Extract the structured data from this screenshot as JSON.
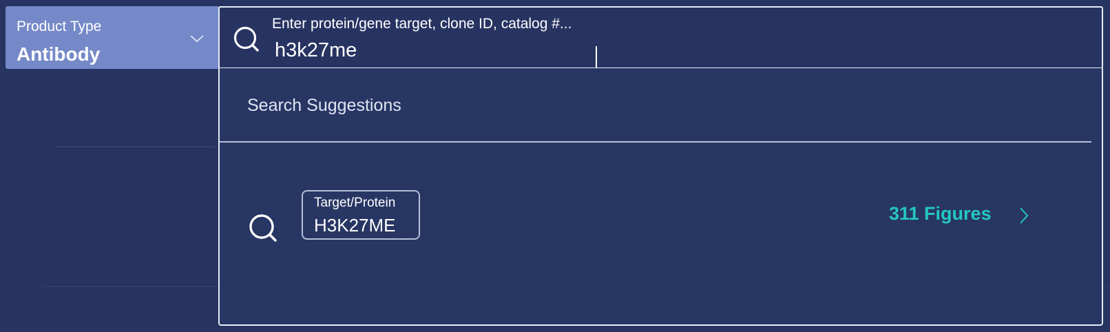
{
  "product_type": {
    "label": "Product Type",
    "value": "Antibody"
  },
  "search": {
    "placeholder": "Enter protein/gene target, clone ID, catalog #...",
    "value": "h3k27me"
  },
  "suggestions": {
    "heading": "Search Suggestions",
    "items": [
      {
        "category": "Target/Protein",
        "term": "H3K27ME",
        "figures": "311 Figures"
      }
    ]
  },
  "colors": {
    "background": "#273462",
    "selector": "#7589c8",
    "accent": "#24c7c0"
  },
  "icons": [
    "search-icon",
    "chevron-down-icon",
    "chevron-right-icon"
  ]
}
